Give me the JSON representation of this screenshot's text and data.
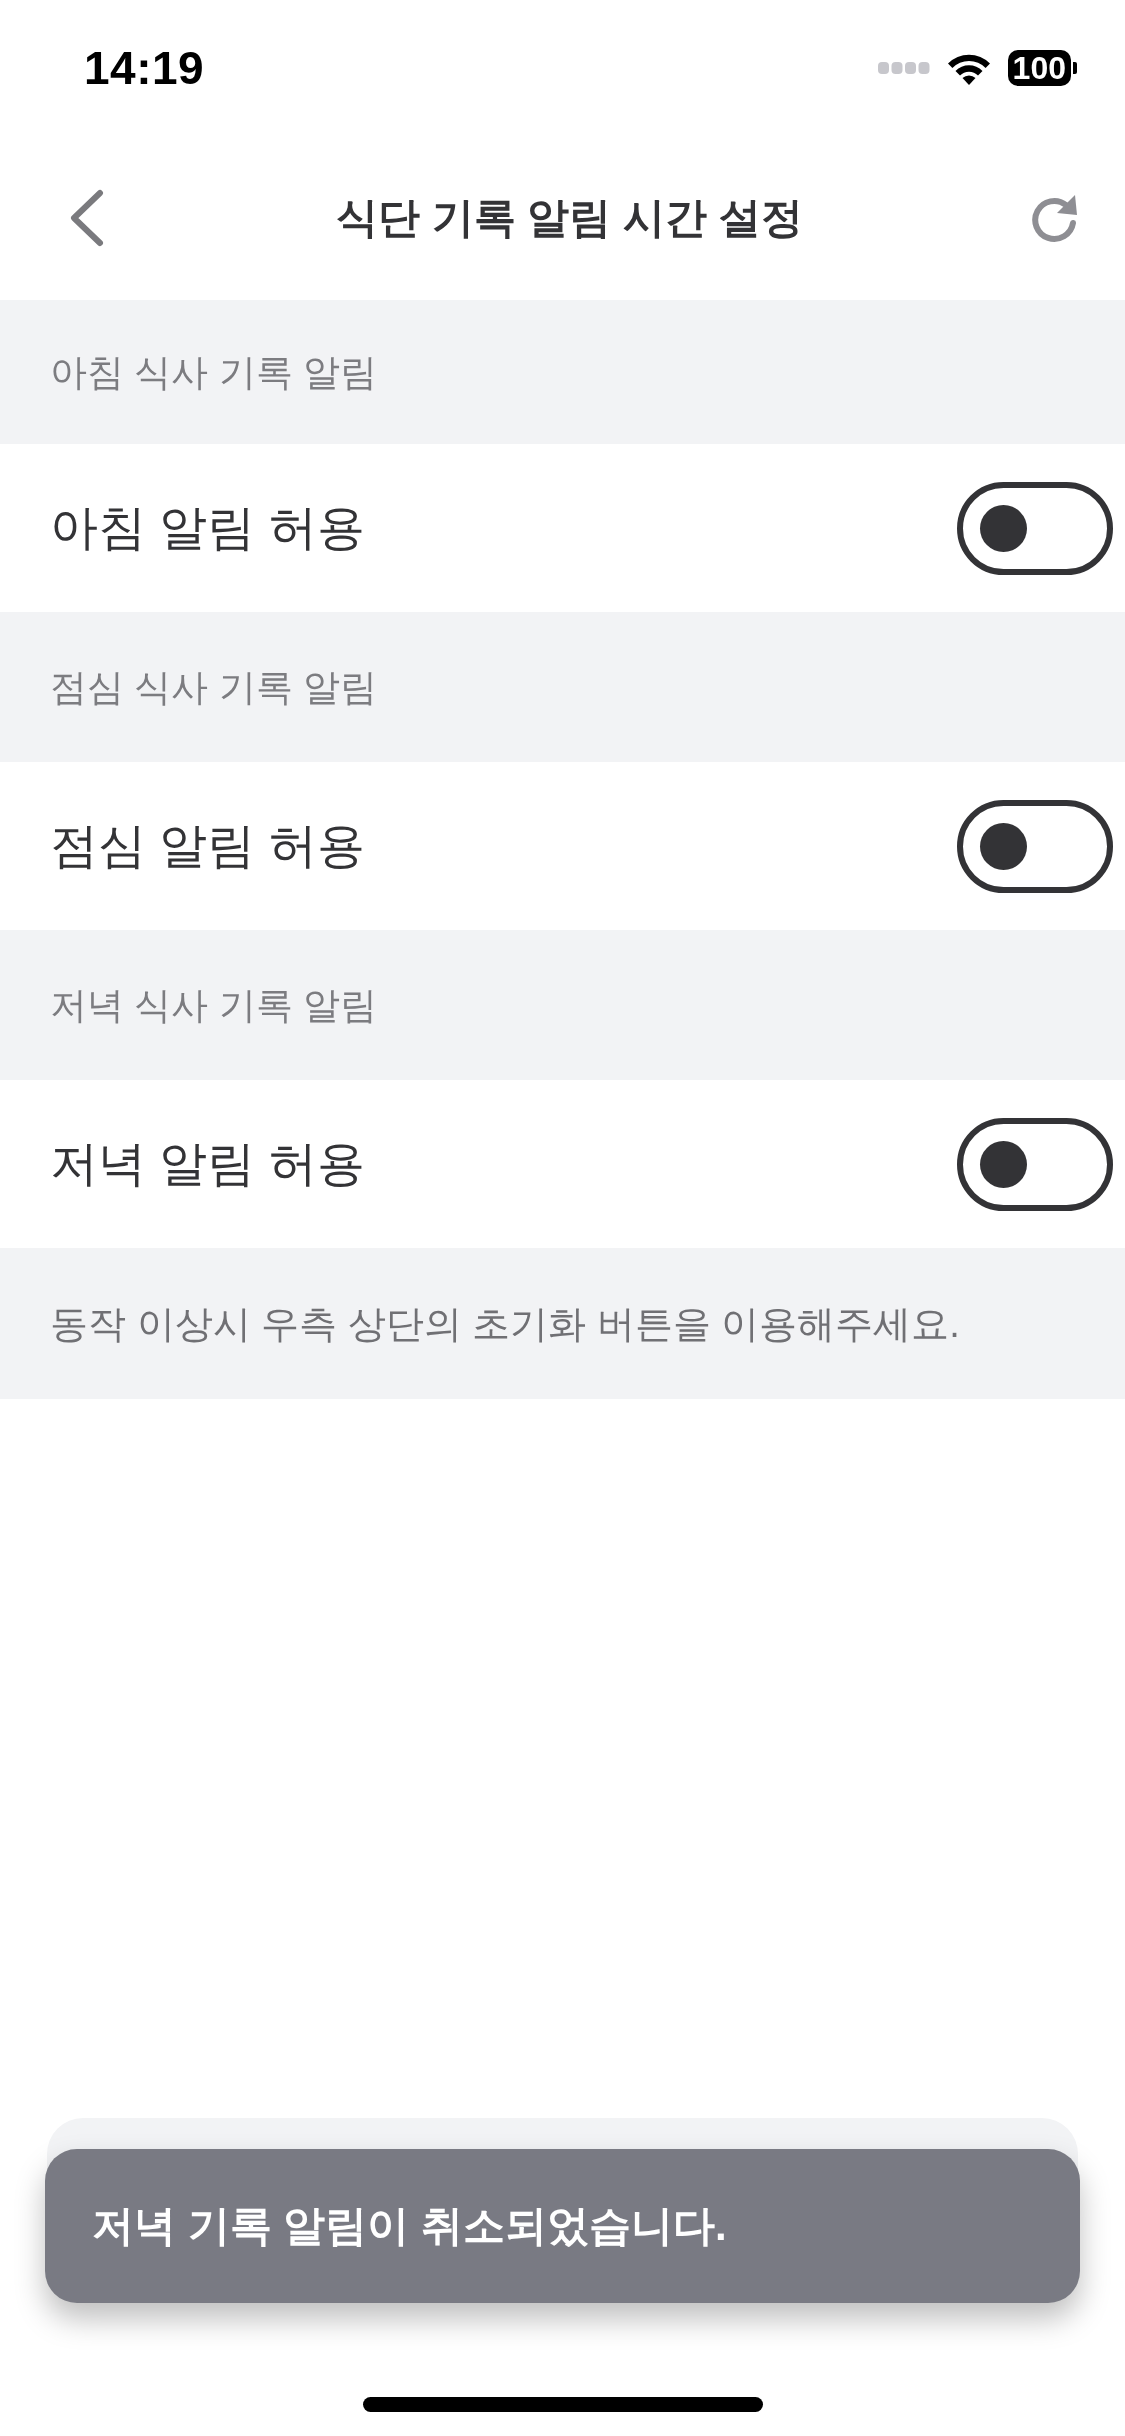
{
  "status_bar": {
    "time": "14:19",
    "battery": "100"
  },
  "header": {
    "title": "식단 기록 알림 시간 설정"
  },
  "sections": [
    {
      "heading": "아침 식사 기록 알림",
      "toggle": {
        "label": "아침 알림 허용",
        "on": false
      }
    },
    {
      "heading": "점심 식사 기록 알림",
      "toggle": {
        "label": "점심 알림 허용",
        "on": false
      }
    },
    {
      "heading": "저녁 식사 기록 알림",
      "toggle": {
        "label": "저녁 알림 허용",
        "on": false
      }
    }
  ],
  "note": "동작 이상시 우측 상단의 초기화 버튼을 이용해주세요.",
  "toast": {
    "message": "저녁 기록 알림이 취소되었습니다."
  }
}
